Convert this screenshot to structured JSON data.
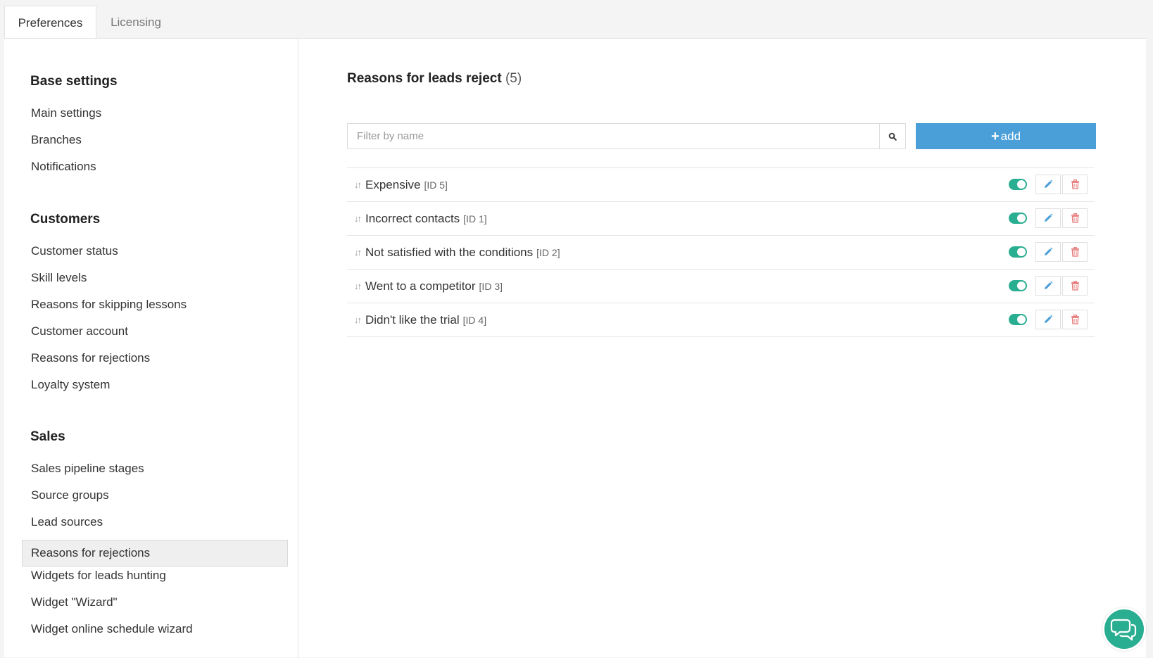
{
  "tabs": [
    {
      "label": "Preferences",
      "active": true
    },
    {
      "label": "Licensing",
      "active": false
    }
  ],
  "sidebar": {
    "sections": [
      {
        "title": "Base settings",
        "items": [
          "Main settings",
          "Branches",
          "Notifications"
        ]
      },
      {
        "title": "Customers",
        "items": [
          "Customer status",
          "Skill levels",
          "Reasons for skipping lessons",
          "Customer account",
          "Reasons for rejections",
          "Loyalty system"
        ]
      },
      {
        "title": "Sales",
        "items": [
          "Sales pipeline stages",
          "Source groups",
          "Lead sources",
          "Reasons for rejections",
          "Widgets for leads hunting",
          "Widget \"Wizard\"",
          "Widget online schedule wizard"
        ]
      }
    ],
    "active_item": "Reasons for rejections (Sales)"
  },
  "main": {
    "title": "Reasons for leads reject",
    "count": "(5)",
    "filter_placeholder": "Filter by name",
    "filter_value": "",
    "add_label": "add",
    "add_icon": "plus-icon",
    "rows": [
      {
        "name": "Expensive",
        "id": "[ID 5]",
        "enabled": true
      },
      {
        "name": "Incorrect contacts",
        "id": "[ID 1]",
        "enabled": true
      },
      {
        "name": "Not satisfied with the conditions",
        "id": "[ID 2]",
        "enabled": true
      },
      {
        "name": "Went to a competitor",
        "id": "[ID 3]",
        "enabled": true
      },
      {
        "name": "Didn't like the trial",
        "id": "[ID 4]",
        "enabled": true
      }
    ]
  },
  "icons": {
    "drag": "sort-arrows-icon",
    "edit": "pencil-icon",
    "delete": "trash-icon",
    "search": "search-icon",
    "chat": "chat-bubbles-icon"
  },
  "colors": {
    "accent_blue": "#4a9fd8",
    "toggle_green": "#2aae91",
    "delete_red": "#e57373",
    "active_nav_bg": "#efefef"
  }
}
